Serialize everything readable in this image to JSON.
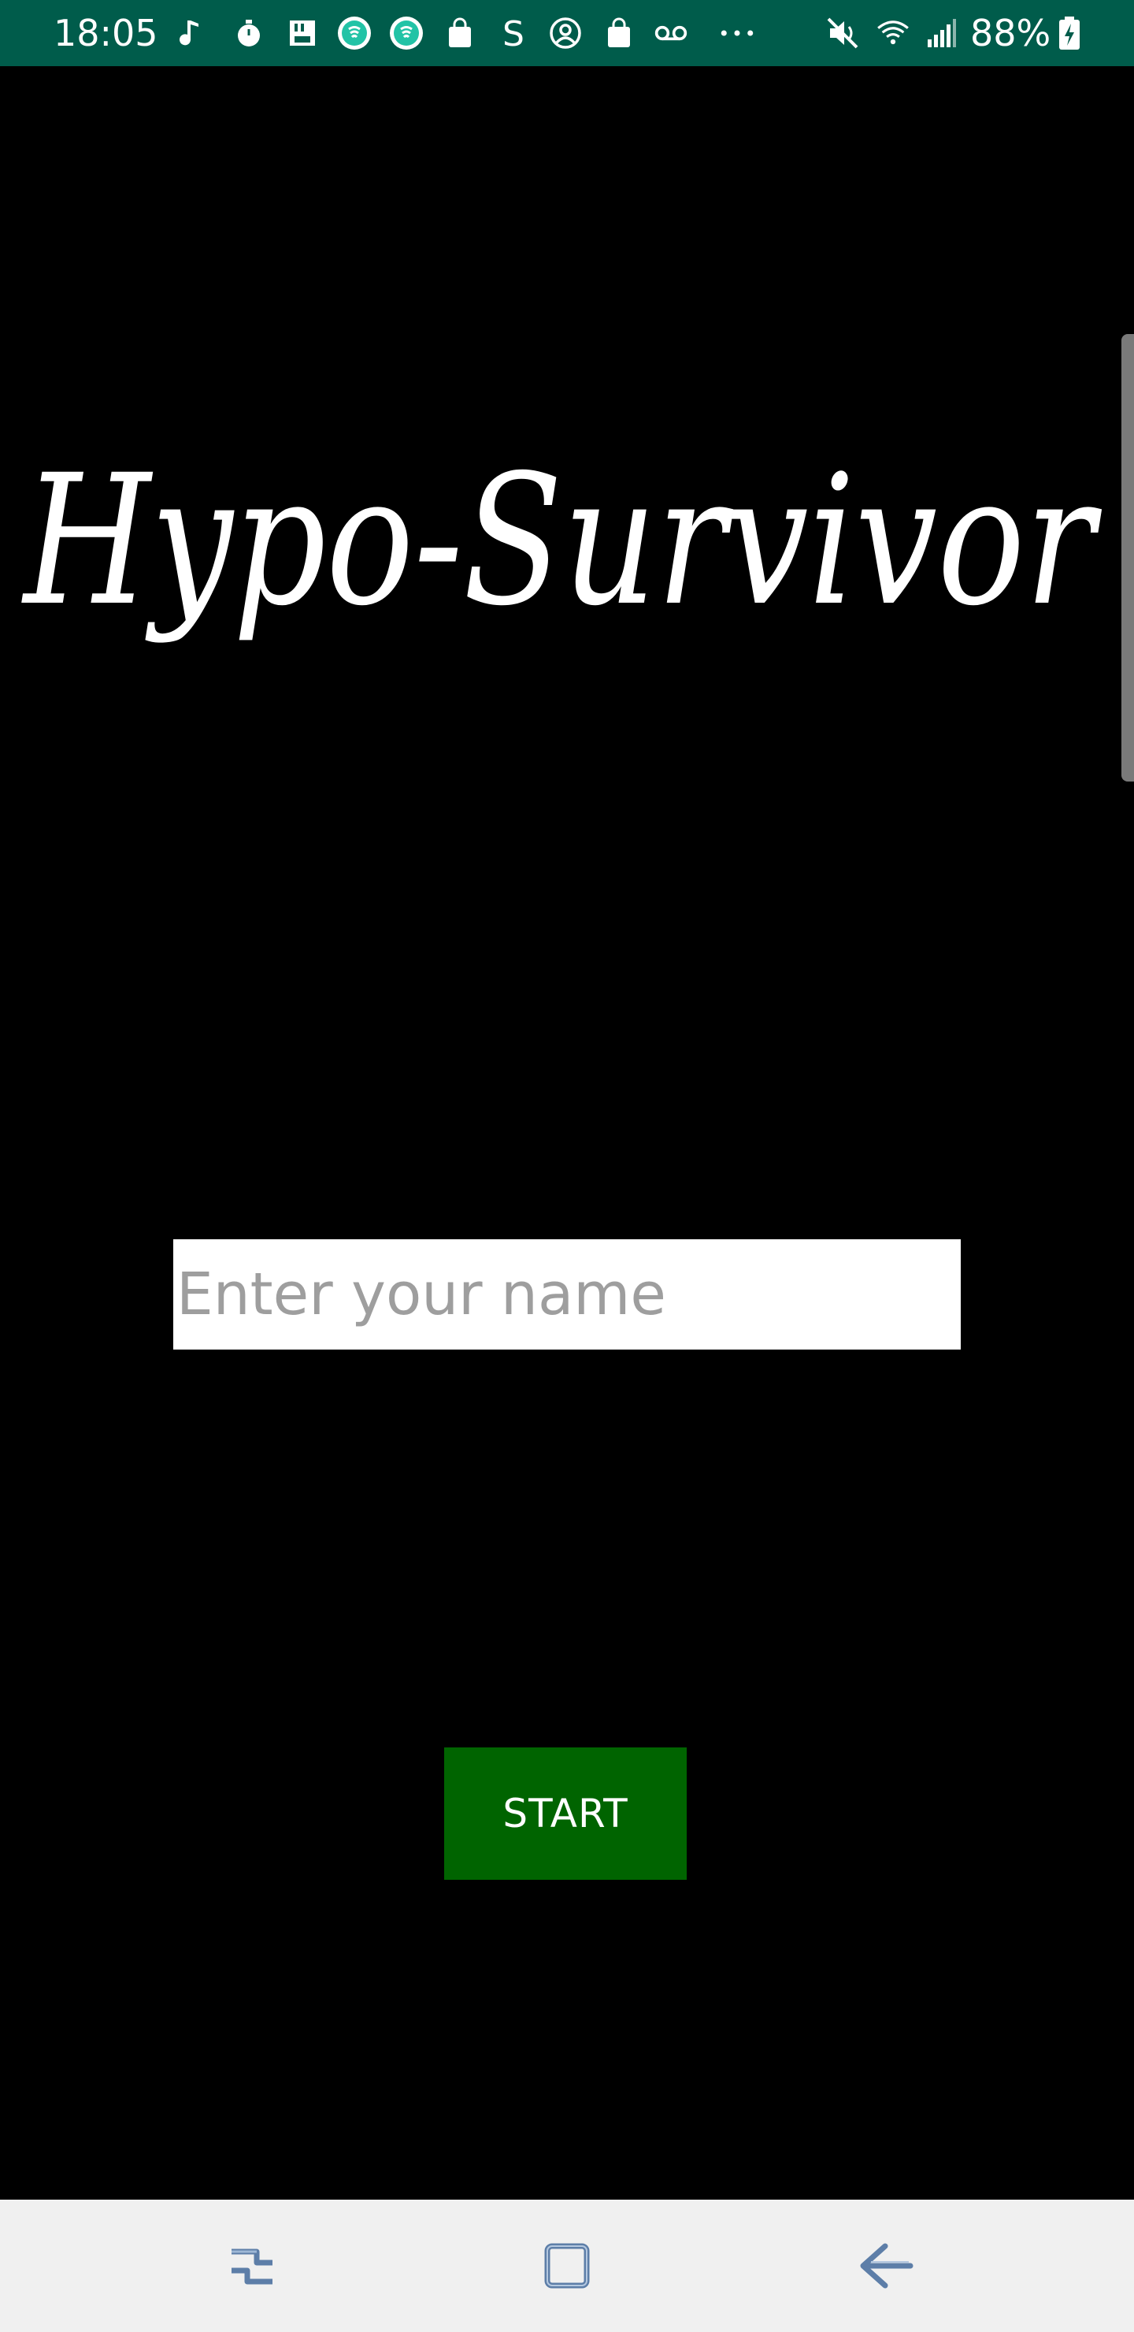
{
  "status_bar": {
    "time": "18:05",
    "battery_percent": "88%",
    "background_color": "#005c4b",
    "icons": [
      "music-note-icon",
      "timer-icon",
      "sd-card-icon",
      "app-circle-icon",
      "app-circle-icon",
      "shopping-bag-icon",
      "s-letter-icon",
      "account-icon",
      "shopping-bag-icon",
      "voicemail-icon",
      "more-dots-icon",
      "mute-icon",
      "wifi-icon",
      "signal-icon",
      "battery-charging-icon"
    ]
  },
  "main": {
    "title": "Hypo-Survivor",
    "name_input": {
      "placeholder": "Enter your name",
      "value": ""
    },
    "start_button_label": "START",
    "start_button_color": "#006400",
    "background_color": "#000000"
  },
  "nav_bar": {
    "background_color": "#f0f0f0",
    "buttons": [
      "recent-apps-icon",
      "home-icon",
      "back-icon"
    ]
  }
}
